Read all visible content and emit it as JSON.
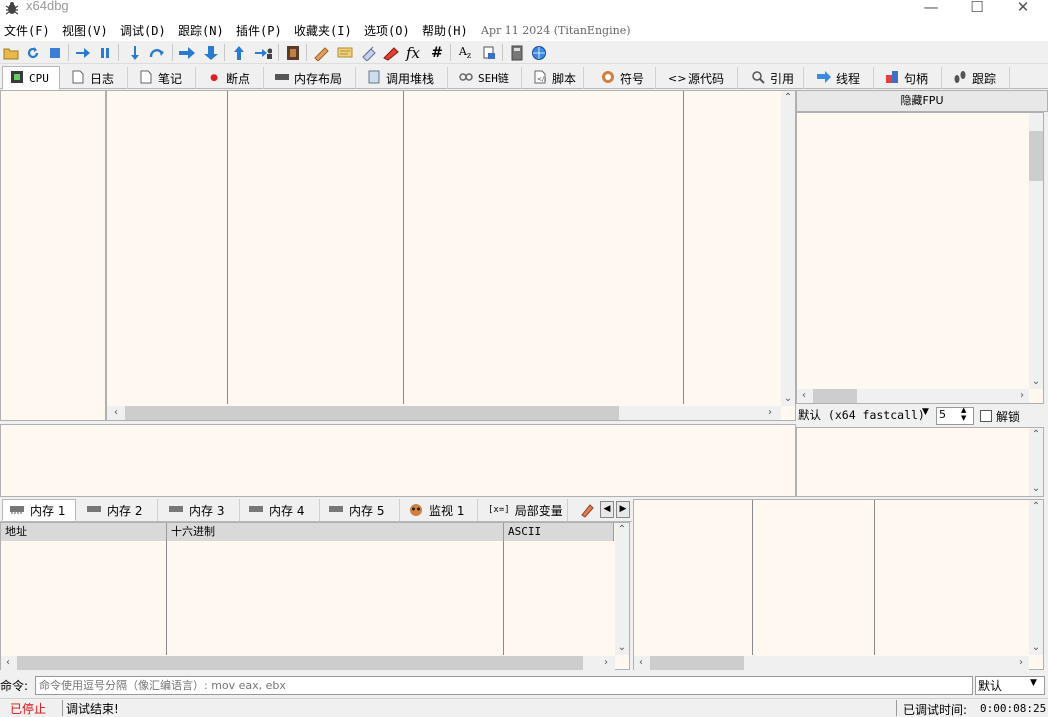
{
  "window": {
    "title": "x64dbg",
    "min": "—",
    "max": "☐",
    "close": "✕"
  },
  "menu": [
    {
      "label": "文件(F)"
    },
    {
      "label": "视图(V)"
    },
    {
      "label": "调试(D)"
    },
    {
      "label": "跟踪(N)"
    },
    {
      "label": "插件(P)"
    },
    {
      "label": "收藏夹(I)"
    },
    {
      "label": "选项(O)"
    },
    {
      "label": "帮助(H)"
    }
  ],
  "build_info": "Apr 11 2024 (TitanEngine)",
  "tabs": [
    {
      "label": "CPU",
      "icon": "cpu-icon"
    },
    {
      "label": "日志",
      "icon": "log-icon"
    },
    {
      "label": "笔记",
      "icon": "notes-icon"
    },
    {
      "label": "断点",
      "icon": "breakpoint-icon"
    },
    {
      "label": "内存布局",
      "icon": "memory-map-icon"
    },
    {
      "label": "调用堆栈",
      "icon": "call-stack-icon"
    },
    {
      "label": "SEH链",
      "icon": "seh-icon"
    },
    {
      "label": "脚本",
      "icon": "script-icon"
    },
    {
      "label": "符号",
      "icon": "symbols-icon"
    },
    {
      "label": "源代码",
      "icon": "source-icon"
    },
    {
      "label": "引用",
      "icon": "references-icon"
    },
    {
      "label": "线程",
      "icon": "threads-icon"
    },
    {
      "label": "句柄",
      "icon": "handles-icon"
    },
    {
      "label": "跟踪",
      "icon": "trace-icon"
    }
  ],
  "registers": {
    "hide_fpu": "隐藏FPU",
    "calling_convention": "默认 (x64 fastcall)",
    "arg_count": "5",
    "unlock_label": "解锁"
  },
  "bottom_tabs": [
    {
      "label": "内存 1",
      "icon": "memory-icon"
    },
    {
      "label": "内存 2",
      "icon": "memory-icon"
    },
    {
      "label": "内存 3",
      "icon": "memory-icon"
    },
    {
      "label": "内存 4",
      "icon": "memory-icon"
    },
    {
      "label": "内存 5",
      "icon": "memory-icon"
    },
    {
      "label": "监视 1",
      "icon": "watch-icon"
    },
    {
      "label": "局部变量",
      "icon": "locals-icon",
      "prefix": "[x=]"
    }
  ],
  "dump_columns": [
    "地址",
    "十六进制",
    "ASCII"
  ],
  "command": {
    "label": "命令:",
    "placeholder": "命令使用逗号分隔（像汇编语言）: mov eax, ebx",
    "mode": "默认"
  },
  "status": {
    "state": "已停止",
    "message": "调试结束!",
    "time_label": "已调试时间:",
    "time_value": "0:00:08:25"
  },
  "colors": {
    "pane_bg": "#fff8f0",
    "stopped": "#e01010"
  }
}
